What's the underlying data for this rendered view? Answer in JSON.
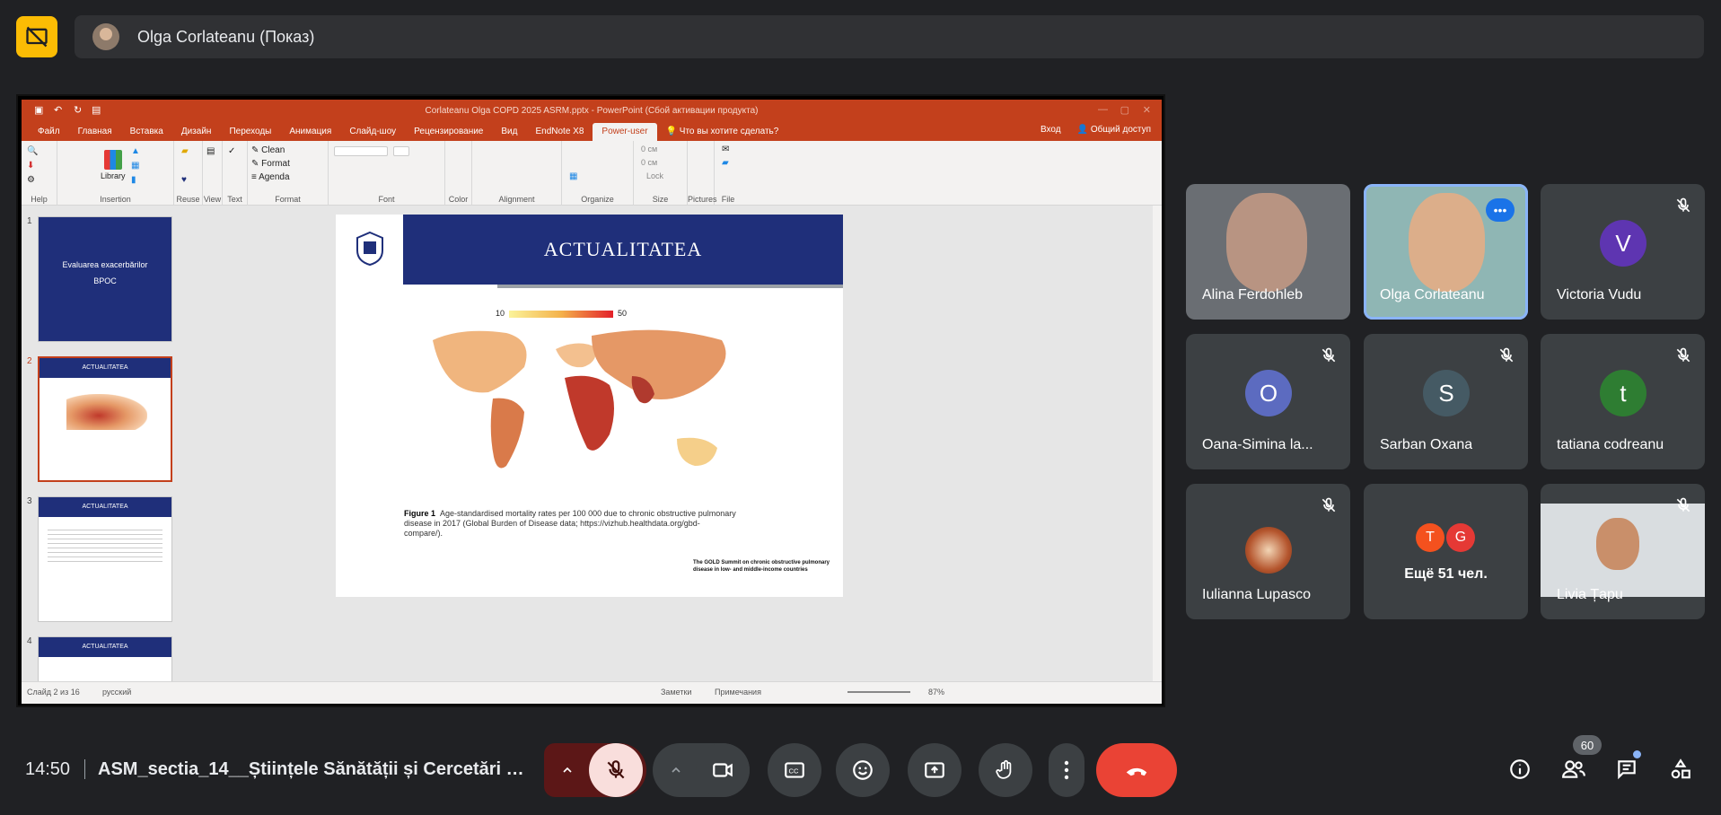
{
  "meet": {
    "presenter_label": "Olga Corlateanu (Показ)",
    "time": "14:50",
    "meeting_title": "ASM_sectia_14__Științele Sănătății și Cercetări B...",
    "participants_count": "60",
    "more_people": "Ещё 51 чел.",
    "more_initials": [
      "T",
      "G"
    ]
  },
  "participants": [
    {
      "name": "Alina Ferdohleb",
      "type": "video"
    },
    {
      "name": "Olga Corlateanu",
      "type": "video",
      "active": true
    },
    {
      "name": "Victoria Vudu",
      "initial": "V",
      "color": "#5e35b1"
    },
    {
      "name": "Oana-Simina la...",
      "initial": "O",
      "color": "#5c6bc0"
    },
    {
      "name": "Sarban Oxana",
      "initial": "S",
      "color": "#455a64"
    },
    {
      "name": "tatiana codreanu",
      "initial": "t",
      "color": "#2e7d32"
    },
    {
      "name": "Iulianna Lupasco",
      "type": "image"
    },
    {
      "name": "Livia Țapu",
      "type": "video"
    }
  ],
  "ppt": {
    "window_title": "Corlateanu Olga COPD 2025 ASRM.pptx - PowerPoint (Сбой активации продукта)",
    "tabs": [
      "Файл",
      "Главная",
      "Вставка",
      "Дизайн",
      "Переходы",
      "Анимация",
      "Слайд-шоу",
      "Рецензирование",
      "Вид",
      "EndNote X8",
      "Power-user"
    ],
    "active_tab": "Power-user",
    "tell_me": "Что вы хотите сделать?",
    "signin": "Вход",
    "share": "Общий доступ",
    "ribbon_groups": [
      "Help",
      "Insertion",
      "Reuse",
      "View",
      "Text",
      "Format",
      "Font",
      "Color",
      "Alignment",
      "Organize",
      "Size",
      "Pictures",
      "File"
    ],
    "ribbon_buttons": {
      "library": "Library",
      "clean": "Clean",
      "format": "Format",
      "agenda": "Agenda",
      "lock": "Lock",
      "size1": "0 см",
      "size2": "0 см"
    },
    "slide_numbers": [
      "1",
      "2",
      "3",
      "4"
    ],
    "thumb1_title": "Evaluarea exacerbărilor",
    "thumb1_sub": "BPOC",
    "thumb_heading": "ACTUALITATEA",
    "slide_title": "ACTUALITATEA",
    "legend_min": "10",
    "legend_max": "50",
    "figure_label": "Figure 1",
    "figure_caption": "Age-standardised mortality rates per 100 000 due to chronic obstructive pulmonary disease in 2017 (Global Burden of Disease data; https://vizhub.healthdata.org/gbd-compare/).",
    "gold_title": "The GOLD Summit on chronic obstructive pulmonary disease in low- and middle-income countries",
    "status_slide": "Слайд 2 из 16",
    "status_lang": "русский",
    "status_notes": "Заметки",
    "status_comments": "Примечания",
    "zoom": "87%"
  }
}
